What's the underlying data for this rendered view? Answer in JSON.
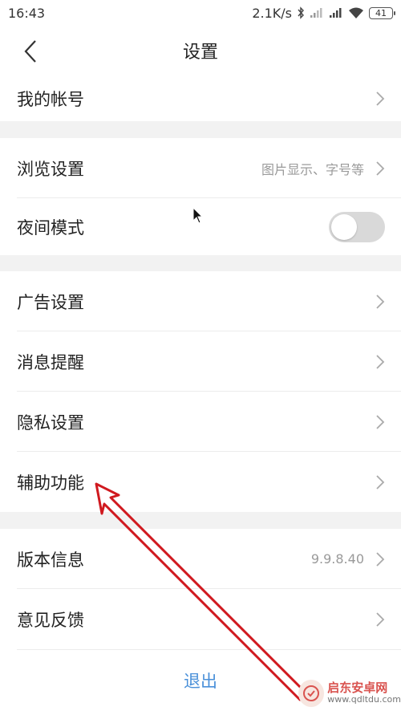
{
  "status_bar": {
    "time": "16:43",
    "network_speed": "2.1K/s",
    "battery": "41",
    "icons": [
      "bluetooth-icon",
      "signal-icon",
      "signal-icon",
      "wifi-icon",
      "battery-icon"
    ]
  },
  "header": {
    "title": "设置",
    "back_icon": "chevron-left-icon"
  },
  "rows": {
    "account": {
      "label": "我的帐号"
    },
    "browse": {
      "label": "浏览设置",
      "value": "图片显示、字号等"
    },
    "night_mode": {
      "label": "夜间模式",
      "toggle_on": false
    },
    "ads": {
      "label": "广告设置"
    },
    "notifications": {
      "label": "消息提醒"
    },
    "privacy": {
      "label": "隐私设置"
    },
    "accessibility": {
      "label": "辅助功能"
    },
    "version": {
      "label": "版本信息",
      "value": "9.9.8.40"
    },
    "feedback": {
      "label": "意见反馈"
    }
  },
  "footer": {
    "logout_label": "退出"
  },
  "colors": {
    "background": "#f2f2f2",
    "logout_blue": "#4a90d9",
    "annotation_red": "#d0191f",
    "toggle_off": "#d9d9d9"
  },
  "watermark": {
    "name": "启东安卓网",
    "url": "www.qdltdu.com"
  }
}
